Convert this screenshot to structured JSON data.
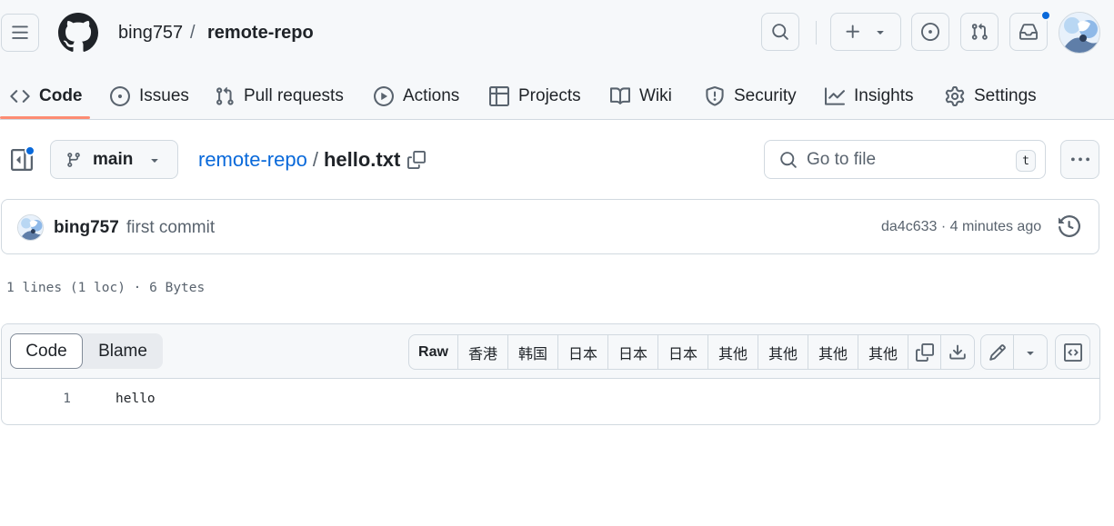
{
  "header": {
    "owner": "bing757",
    "separator": "/",
    "repo": "remote-repo",
    "has_notification": true
  },
  "nav": {
    "tabs": [
      {
        "label": "Code",
        "icon": "code-icon",
        "selected": true
      },
      {
        "label": "Issues",
        "icon": "issue-opened-icon"
      },
      {
        "label": "Pull requests",
        "icon": "git-pull-request-icon"
      },
      {
        "label": "Actions",
        "icon": "play-icon"
      },
      {
        "label": "Projects",
        "icon": "table-icon"
      },
      {
        "label": "Wiki",
        "icon": "book-icon"
      },
      {
        "label": "Security",
        "icon": "shield-icon"
      },
      {
        "label": "Insights",
        "icon": "graph-icon"
      },
      {
        "label": "Settings",
        "icon": "gear-icon"
      }
    ],
    "underline_color": "#fd8c73"
  },
  "file_header": {
    "branch": "main",
    "breadcrumb_repo": "remote-repo",
    "breadcrumb_sep": "/",
    "file_name": "hello.txt",
    "goto_placeholder": "Go to file",
    "goto_shortcut": "t"
  },
  "commit": {
    "author": "bing757",
    "message": "first commit",
    "meta": "da4c633 · 4 minutes ago"
  },
  "file_info": "1 lines (1 loc) · 6 Bytes",
  "code_view": {
    "tabs": {
      "code": "Code",
      "blame": "Blame"
    },
    "buttons": {
      "raw": "Raw",
      "b1": "香港",
      "b2": "韩国",
      "b3": "日本",
      "b4": "日本",
      "b5": "日本",
      "b6": "其他",
      "b7": "其他",
      "b8": "其他",
      "b9": "其他"
    },
    "lines": [
      {
        "number": "1",
        "text": "hello"
      }
    ]
  },
  "colors": {
    "accent": "#0969da",
    "border": "#d1d9e0",
    "header_bg": "#f6f8fa",
    "muted": "#59636e"
  }
}
